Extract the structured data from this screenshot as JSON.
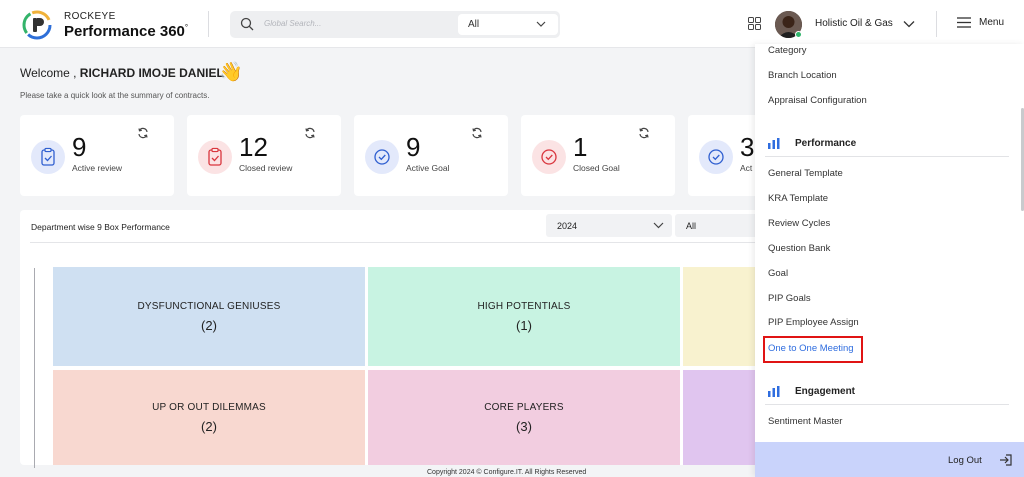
{
  "header": {
    "logo_top": "ROCKEYE",
    "logo_bottom": "Performance 360",
    "logo_degree": "°",
    "search_placeholder": "Global Search...",
    "search_scope": "All",
    "org_name": "Holistic Oil & Gas",
    "menu_label": "Menu"
  },
  "welcome": {
    "prefix": "Welcome , ",
    "name": "RICHARD IMOJE DANIEL",
    "wave": "👋",
    "subtitle": "Please take a quick look at the summary of contracts."
  },
  "cards": [
    {
      "value": "9",
      "label": "Active review",
      "icon": "clipboard-check-icon",
      "color": "#2f5fd0"
    },
    {
      "value": "12",
      "label": "Closed review",
      "icon": "clipboard-check-icon",
      "color": "#d9363e"
    },
    {
      "value": "9",
      "label": "Active Goal",
      "icon": "check-circle-icon",
      "color": "#2f5fd0"
    },
    {
      "value": "1",
      "label": "Closed Goal",
      "icon": "check-circle-icon",
      "color": "#d9363e"
    },
    {
      "value": "3",
      "label": "Act",
      "icon": "check-circle-icon",
      "color": "#2f5fd0"
    }
  ],
  "ninebox": {
    "title": "Department wise 9 Box Performance",
    "year": "2024",
    "filter": "All",
    "boxes": [
      {
        "title": "DYSFUNCTIONAL GENIUSES",
        "count": "(2)",
        "color": "#cfe0f2"
      },
      {
        "title": "HIGH POTENTIALS",
        "count": "(1)",
        "color": "#c8f3e2"
      },
      {
        "title": "",
        "count": "",
        "color": "#f8f2cf"
      },
      {
        "title": "UP OR OUT DILEMMAS",
        "count": "(2)",
        "color": "#f8d8d0"
      },
      {
        "title": "CORE PLAYERS",
        "count": "(3)",
        "color": "#f2cde0"
      },
      {
        "title": "",
        "count": "",
        "color": "#e0c5ef"
      }
    ]
  },
  "footer": "Copyright 2024 © Configure.IT. All Rights Reserved",
  "menu": {
    "top_items": [
      "Category",
      "Branch Location",
      "Appraisal Configuration"
    ],
    "section_performance": "Performance",
    "performance_items": [
      "General Template",
      "KRA Template",
      "Review Cycles",
      "Question Bank",
      "Goal",
      "PIP Goals",
      "PIP Employee Assign",
      "One to One Meeting"
    ],
    "section_engagement": "Engagement",
    "engagement_items": [
      "Sentiment Master"
    ],
    "logout": "Log Out",
    "accent": "#2f6ddf",
    "highlight": "#e01414"
  }
}
